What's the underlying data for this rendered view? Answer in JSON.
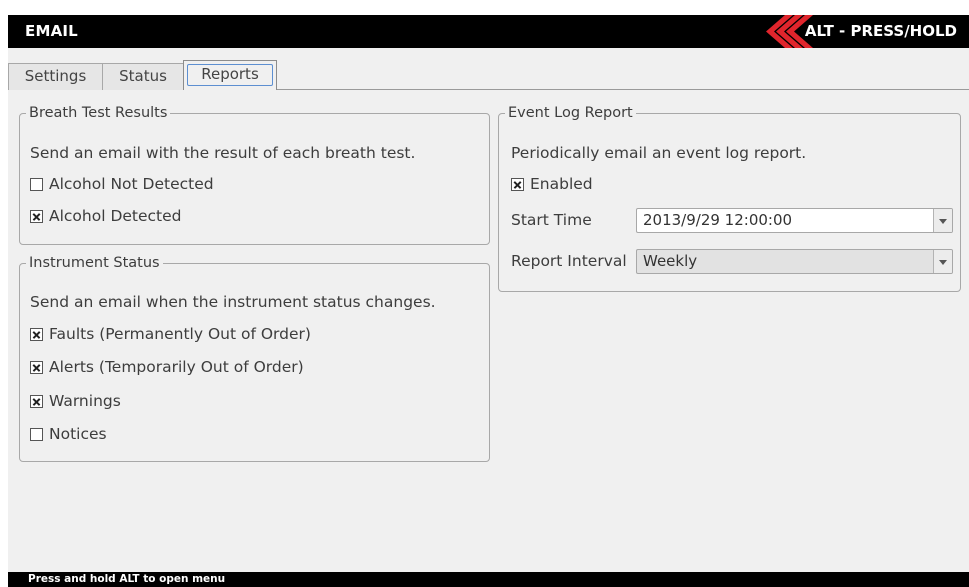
{
  "header": {
    "title": "EMAIL",
    "alt_hint": "ALT - PRESS/HOLD"
  },
  "tabs": [
    {
      "label": "Settings",
      "active": false
    },
    {
      "label": "Status",
      "active": false
    },
    {
      "label": "Reports",
      "active": true
    }
  ],
  "breath_test": {
    "title": "Breath Test Results",
    "description": "Send an email with the result of each breath test.",
    "options": [
      {
        "label": "Alcohol Not Detected",
        "checked": false
      },
      {
        "label": "Alcohol Detected",
        "checked": true
      }
    ]
  },
  "instrument_status": {
    "title": "Instrument Status",
    "description": "Send an email when the instrument status changes.",
    "options": [
      {
        "label": "Faults (Permanently Out of Order)",
        "checked": true
      },
      {
        "label": "Alerts (Temporarily Out of Order)",
        "checked": true
      },
      {
        "label": "Warnings",
        "checked": true
      },
      {
        "label": "Notices",
        "checked": false
      }
    ]
  },
  "event_log": {
    "title": "Event Log Report",
    "description": "Periodically email an event log report.",
    "enabled_label": "Enabled",
    "enabled": true,
    "start_time_label": "Start Time",
    "start_time_value": "2013/9/29 12:00:00",
    "report_interval_label": "Report Interval",
    "report_interval_value": "Weekly"
  },
  "footer": {
    "hint": "Press and hold ALT to open menu"
  },
  "colors": {
    "accent_red": "#e0252c",
    "focus_blue": "#5d8fd1"
  }
}
